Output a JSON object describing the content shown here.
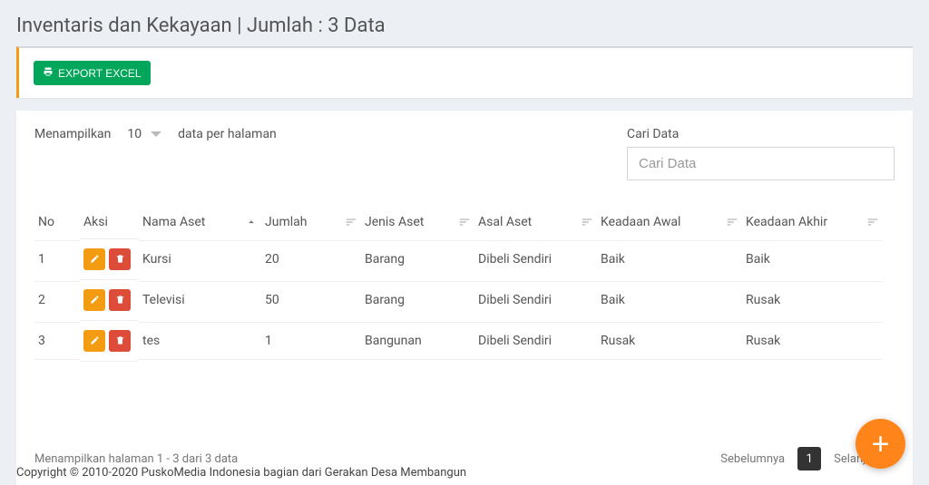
{
  "page_title": "Inventaris dan Kekayaan | Jumlah : 3 Data",
  "export_button_label": "EXPORT EXCEL",
  "controls": {
    "show_label": "Menampilkan",
    "per_page_value": "10",
    "per_page_suffix": "data per halaman",
    "search_label": "Cari Data",
    "search_placeholder": "Cari Data"
  },
  "columns": {
    "no": "No",
    "aksi": "Aksi",
    "nama_aset": "Nama Aset",
    "jumlah": "Jumlah",
    "jenis_aset": "Jenis Aset",
    "asal_aset": "Asal Aset",
    "keadaan_awal": "Keadaan Awal",
    "keadaan_akhir": "Keadaan Akhir"
  },
  "rows": [
    {
      "no": "1",
      "nama_aset": "Kursi",
      "jumlah": "20",
      "jenis_aset": "Barang",
      "asal_aset": "Dibeli Sendiri",
      "keadaan_awal": "Baik",
      "keadaan_akhir": "Baik"
    },
    {
      "no": "2",
      "nama_aset": "Televisi",
      "jumlah": "50",
      "jenis_aset": "Barang",
      "asal_aset": "Dibeli Sendiri",
      "keadaan_awal": "Baik",
      "keadaan_akhir": "Rusak"
    },
    {
      "no": "3",
      "nama_aset": "tes",
      "jumlah": "1",
      "jenis_aset": "Bangunan",
      "asal_aset": "Dibeli Sendiri",
      "keadaan_awal": "Rusak",
      "keadaan_akhir": "Rusak"
    }
  ],
  "footer": {
    "info": "Menampilkan halaman 1 - 3 dari 3 data",
    "prev": "Sebelumnya",
    "current": "1",
    "next": "Selanjutnya"
  },
  "copyright": "Copyright © 2010-2020 PuskoMedia Indonesia bagian dari Gerakan Desa Membangun"
}
